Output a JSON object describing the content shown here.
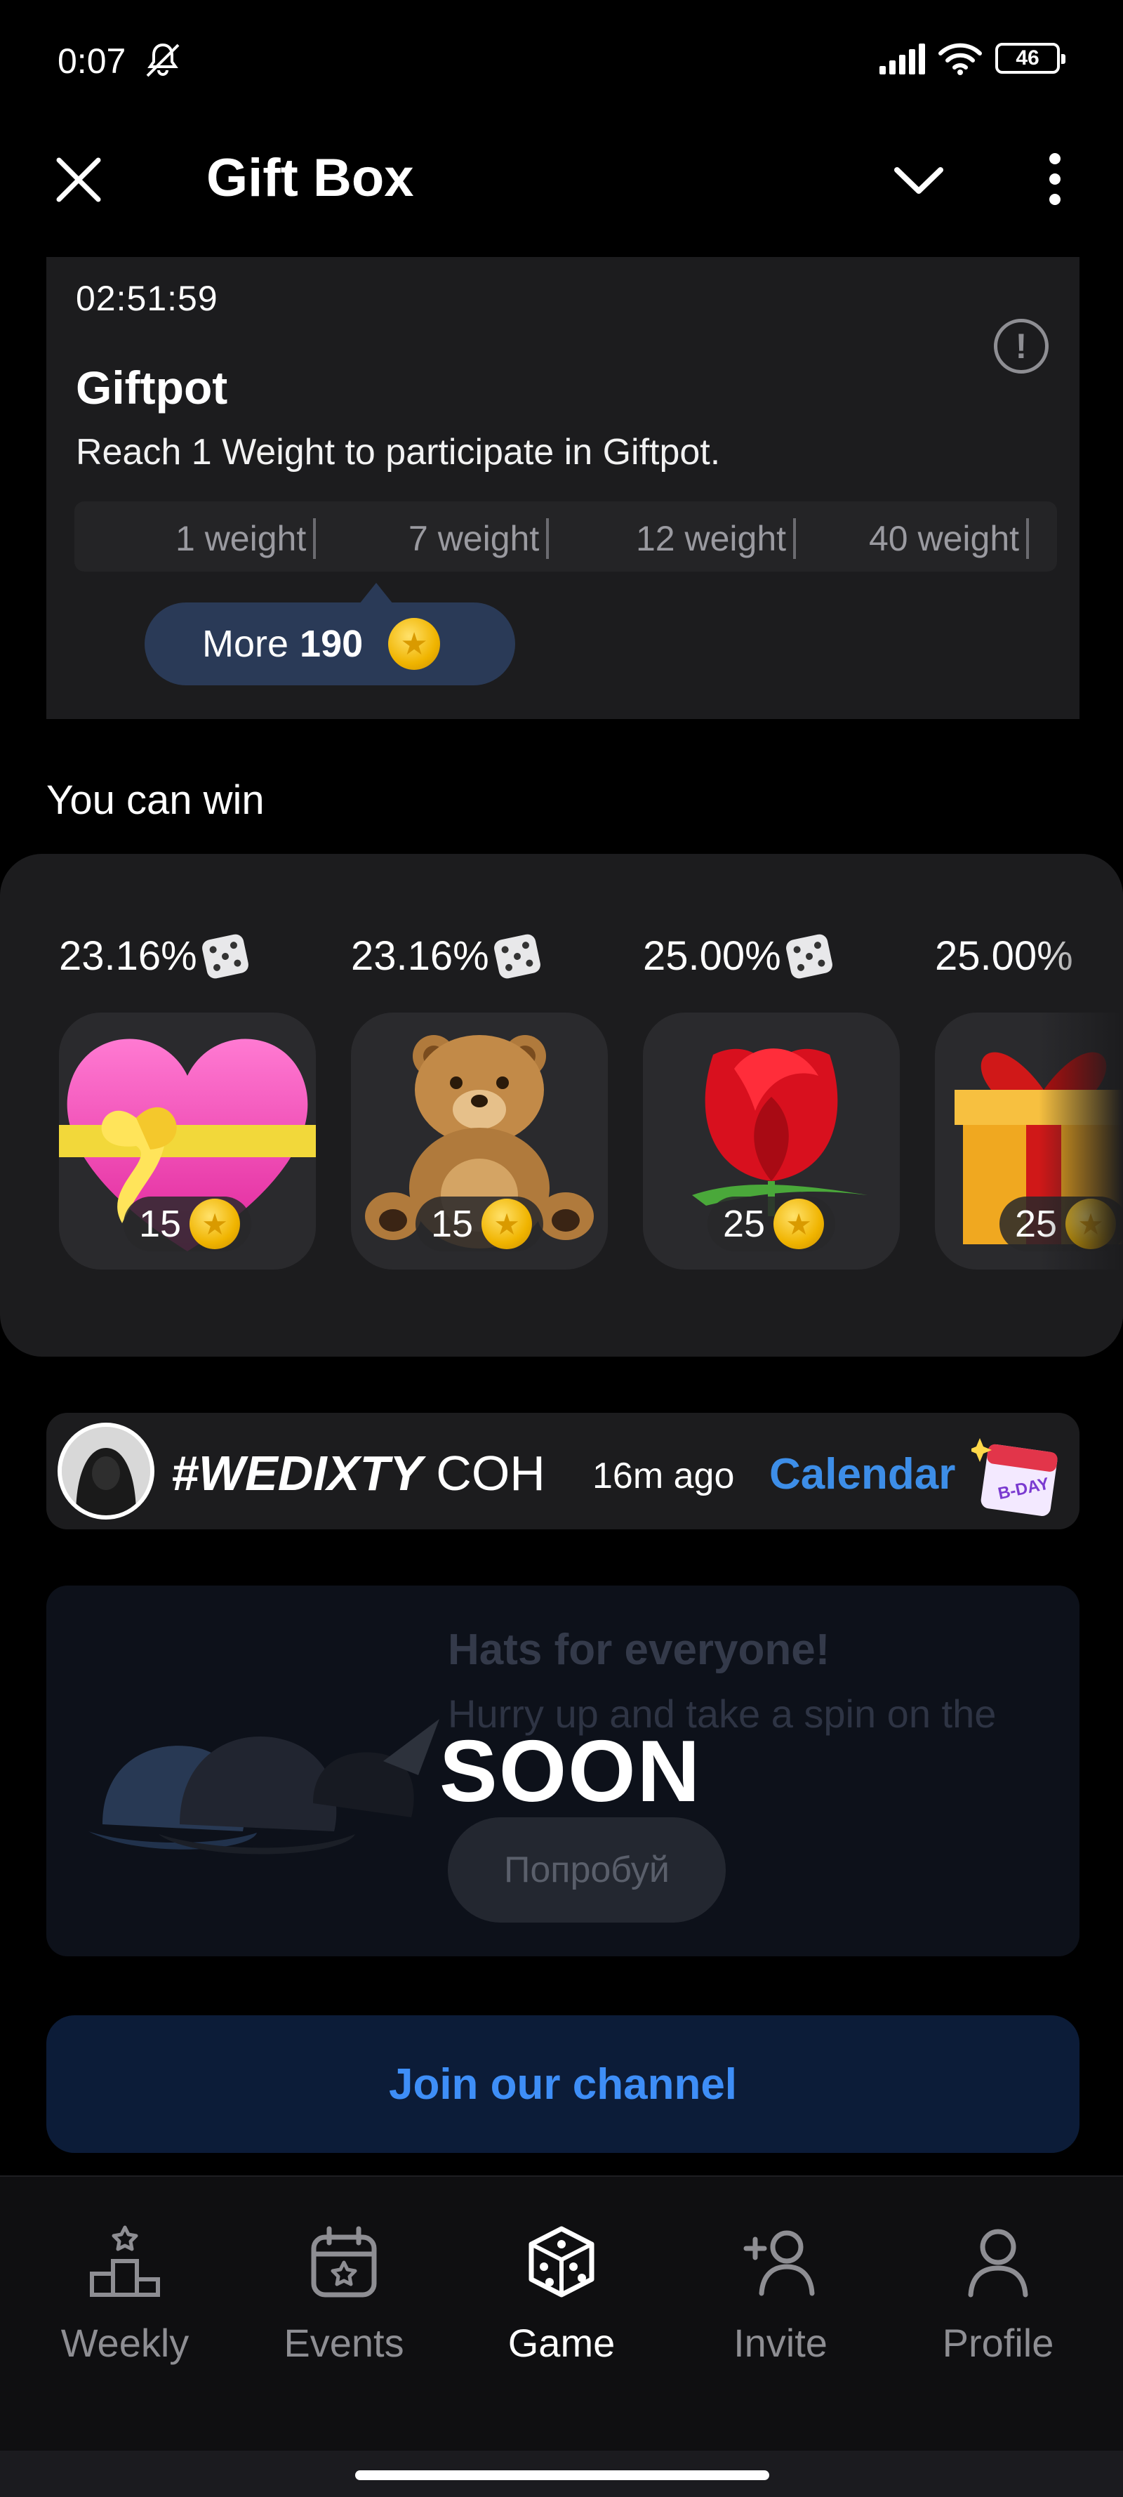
{
  "status_bar": {
    "time": "0:07",
    "battery": "46"
  },
  "header": {
    "title": "Gift Box"
  },
  "giftpot": {
    "timer": "02:51:59",
    "title": "Giftpot",
    "description": "Reach 1 Weight to participate in Giftpot.",
    "weights": [
      "1 weight",
      "7 weight",
      "12 weight",
      "40 weight"
    ],
    "more_label": "More",
    "more_value": "190"
  },
  "win": {
    "title": "You can win",
    "prizes": [
      {
        "chance": "23.16%",
        "price": "15",
        "gift": "heart-gift"
      },
      {
        "chance": "23.16%",
        "price": "15",
        "gift": "teddy-bear"
      },
      {
        "chance": "25.00%",
        "price": "25",
        "gift": "red-rose"
      },
      {
        "chance": "25.00%",
        "price": "25",
        "gift": "gift-box"
      }
    ]
  },
  "activity": {
    "name_bold": "#WEDIXTY",
    "name_rest": "COH",
    "time": "16m ago",
    "link": "Calendar"
  },
  "soon_banner": {
    "title": "Hats for everyone!",
    "subtitle": "Hurry up and take a spin on the",
    "button": "Попробуй",
    "overlay": "SOON"
  },
  "join_button": "Join our channel",
  "nav": {
    "items": [
      {
        "label": "Weekly",
        "icon": "podium-icon"
      },
      {
        "label": "Events",
        "icon": "calendar-star-icon"
      },
      {
        "label": "Game",
        "icon": "dice-icon"
      },
      {
        "label": "Invite",
        "icon": "add-user-icon"
      },
      {
        "label": "Profile",
        "icon": "user-icon"
      }
    ],
    "active": "Game"
  },
  "colors": {
    "accent": "#3d8ee8",
    "panel": "#1c1c1e",
    "pill": "#2a3a57",
    "coin": "#f0b400"
  }
}
